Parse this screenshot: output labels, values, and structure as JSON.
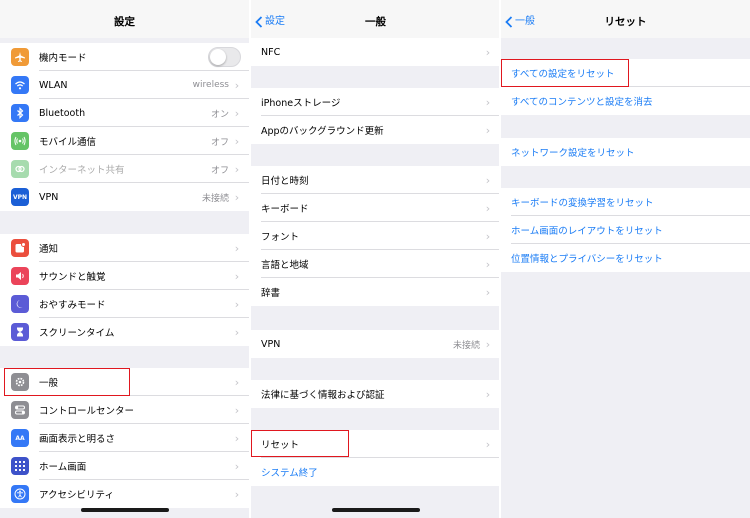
{
  "colors": {
    "accent": "#1a7cf5",
    "highlight": "#e0171f"
  },
  "panel1": {
    "title": "設定",
    "group1": [
      {
        "label": "機内モード",
        "icon": "airplane-icon",
        "color": "#f09a37",
        "toggle": true
      },
      {
        "label": "WLAN",
        "icon": "wifi-icon",
        "color": "#3478f6",
        "detail": "wireless"
      },
      {
        "label": "Bluetooth",
        "icon": "bluetooth-icon",
        "color": "#3478f6",
        "detail": "オン"
      },
      {
        "label": "モバイル通信",
        "icon": "cellular-icon",
        "color": "#65c466",
        "detail": "オフ"
      },
      {
        "label": "インターネット共有",
        "icon": "hotspot-icon",
        "color": "#a6dbae",
        "detail": "オフ",
        "dim": true
      },
      {
        "label": "VPN",
        "icon": "vpn-icon",
        "color": "#1b5fd6",
        "detail": "未接続",
        "badge": "VPN"
      }
    ],
    "group2": [
      {
        "label": "通知",
        "icon": "notifications-icon",
        "color": "#eb4e3d"
      },
      {
        "label": "サウンドと触覚",
        "icon": "sound-icon",
        "color": "#eb445a"
      },
      {
        "label": "おやすみモード",
        "icon": "moon-icon",
        "color": "#5b5bd6"
      },
      {
        "label": "スクリーンタイム",
        "icon": "hourglass-icon",
        "color": "#5b5bd6"
      }
    ],
    "group3": [
      {
        "label": "一般",
        "icon": "gear-icon",
        "color": "#8e8e93"
      },
      {
        "label": "コントロールセンター",
        "icon": "control-center-icon",
        "color": "#8e8e93"
      },
      {
        "label": "画面表示と明るさ",
        "icon": "display-icon",
        "color": "#3478f6",
        "badge": "AA"
      },
      {
        "label": "ホーム画面",
        "icon": "home-screen-icon",
        "color": "#3d52c9"
      },
      {
        "label": "アクセシビリティ",
        "icon": "accessibility-icon",
        "color": "#3478f6"
      }
    ]
  },
  "panel2": {
    "back": "設定",
    "title": "一般",
    "groups": [
      [
        {
          "label": "NFC"
        }
      ],
      [
        {
          "label": "iPhoneストレージ"
        },
        {
          "label": "Appのバックグラウンド更新"
        }
      ],
      [
        {
          "label": "日付と時刻"
        },
        {
          "label": "キーボード"
        },
        {
          "label": "フォント"
        },
        {
          "label": "言語と地域"
        },
        {
          "label": "辞書"
        }
      ],
      [
        {
          "label": "VPN",
          "detail": "未接続"
        }
      ],
      [
        {
          "label": "法律に基づく情報および認証"
        }
      ],
      [
        {
          "label": "リセット"
        },
        {
          "label": "システム終了",
          "blue": true,
          "nochev": true
        }
      ]
    ]
  },
  "panel3": {
    "back": "一般",
    "title": "リセット",
    "groups": [
      [
        {
          "label": "すべての設定をリセット"
        },
        {
          "label": "すべてのコンテンツと設定を消去"
        }
      ],
      [
        {
          "label": "ネットワーク設定をリセット"
        }
      ],
      [
        {
          "label": "キーボードの変換学習をリセット"
        },
        {
          "label": "ホーム画面のレイアウトをリセット"
        },
        {
          "label": "位置情報とプライバシーをリセット"
        }
      ]
    ]
  }
}
